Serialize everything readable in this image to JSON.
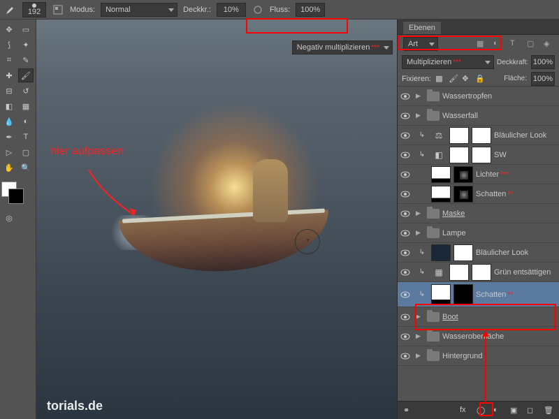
{
  "topbar": {
    "brush_size": "192",
    "mode_label": "Modus:",
    "mode_value": "Normal",
    "opacity_label": "Deckkr.:",
    "opacity_value": "10%",
    "flow_label": "Fluss:",
    "flow_value": "100%",
    "canvas_blend": "Negativ multiplizieren"
  },
  "panels": {
    "tab": "Ebenen",
    "kind_label": "Art",
    "blend_value": "Multiplizieren",
    "opacity_label": "Deckkraft:",
    "opacity_value": "100%",
    "lock_label": "Fixieren:",
    "fill_label": "Fläche:",
    "fill_value": "100%"
  },
  "layers": [
    {
      "type": "group",
      "name": "Wassertropfen",
      "vis": true
    },
    {
      "type": "group",
      "name": "Wasserfall",
      "vis": true
    },
    {
      "type": "adj",
      "name": "Bläulicher Look",
      "vis": true,
      "clip": true,
      "icon": "balance",
      "thumb": "white",
      "mask": "white"
    },
    {
      "type": "adj",
      "name": "SW",
      "vis": true,
      "clip": true,
      "icon": "bw",
      "thumb": "white",
      "mask": "white"
    },
    {
      "type": "adj",
      "name": "Lichter",
      "vis": true,
      "clip": false,
      "icon": "",
      "thumb": "grad",
      "mask": "mask",
      "stars": "***"
    },
    {
      "type": "adj",
      "name": "Schatten",
      "vis": true,
      "clip": false,
      "icon": "",
      "thumb": "black-grad",
      "mask": "mask",
      "stars": "**"
    },
    {
      "type": "group",
      "name": "Maske",
      "vis": true,
      "underline": true
    },
    {
      "type": "group",
      "name": "Lampe",
      "vis": true
    },
    {
      "type": "adj",
      "name": "Bläulicher Look",
      "vis": true,
      "clip": true,
      "icon": "",
      "thumb": "dark",
      "mask": "white"
    },
    {
      "type": "adj",
      "name": "Grün entsättigen",
      "vis": true,
      "clip": true,
      "icon": "hue",
      "thumb": "white",
      "mask": "white"
    },
    {
      "type": "adj",
      "name": "Schatten",
      "vis": true,
      "clip": true,
      "icon": "",
      "thumb": "black-grad",
      "mask": "black",
      "stars": "**",
      "selected": true,
      "tall": true
    },
    {
      "type": "group",
      "name": "Boot",
      "vis": true,
      "underline": true
    },
    {
      "type": "group",
      "name": "Wasseroberfläche",
      "vis": true
    },
    {
      "type": "group",
      "name": "Hintergrund",
      "vis": true
    }
  ],
  "annotations": {
    "canvas_note": "hier aufpassen",
    "watermark": "torials.de"
  },
  "colors": {
    "highlight": "#ff0000",
    "accent": "#5a7aa0"
  }
}
